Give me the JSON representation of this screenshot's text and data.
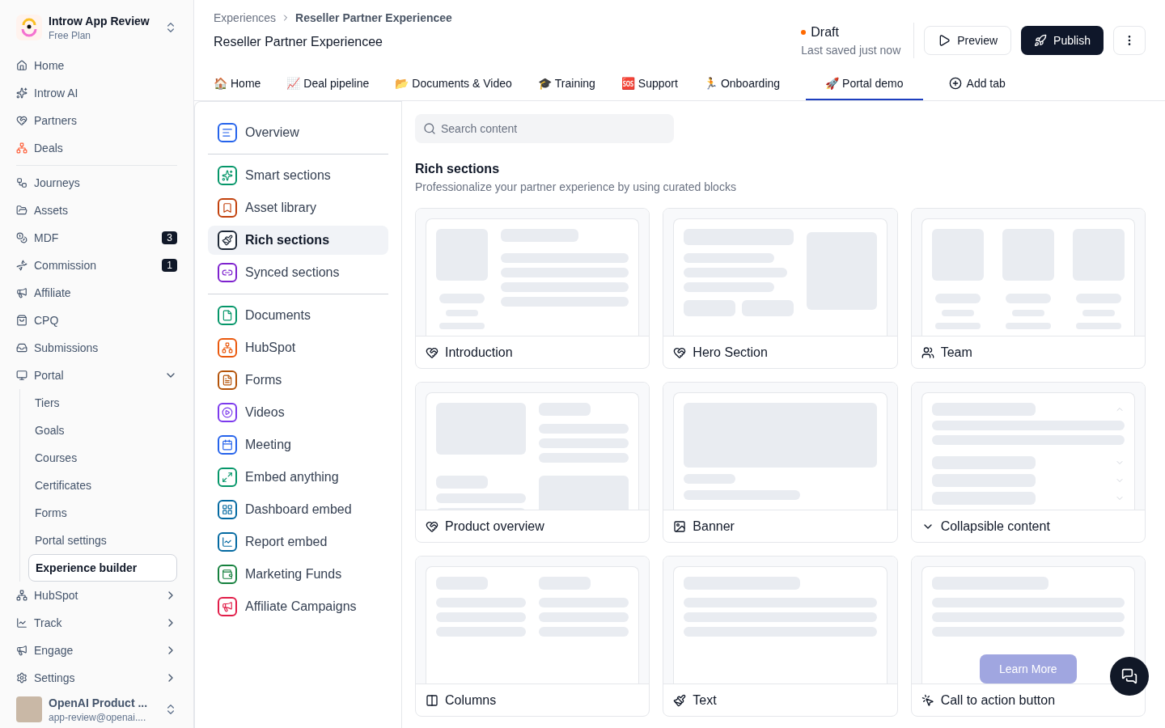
{
  "workspace": {
    "name": "Introw App Review",
    "plan": "Free Plan"
  },
  "nav": [
    {
      "kind": "item",
      "label": "Home"
    },
    {
      "kind": "item",
      "label": "Introw AI"
    },
    {
      "kind": "item",
      "label": "Partners"
    },
    {
      "kind": "item",
      "label": "Deals"
    },
    {
      "kind": "divider"
    },
    {
      "kind": "item",
      "label": "Journeys"
    },
    {
      "kind": "item",
      "label": "Assets"
    },
    {
      "kind": "item",
      "label": "MDF",
      "badge": "3"
    },
    {
      "kind": "item",
      "label": "Commission",
      "badge": "1"
    },
    {
      "kind": "item",
      "label": "Affiliate"
    },
    {
      "kind": "item",
      "label": "CPQ"
    },
    {
      "kind": "item",
      "label": "Submissions"
    },
    {
      "kind": "group",
      "label": "Portal",
      "expanded": true,
      "children": [
        {
          "label": "Tiers",
          "selected": false
        },
        {
          "label": "Goals",
          "selected": false
        },
        {
          "label": "Courses",
          "selected": false
        },
        {
          "label": "Certificates",
          "selected": false
        },
        {
          "label": "Forms",
          "selected": false
        },
        {
          "label": "Portal settings",
          "selected": false
        },
        {
          "label": "Experience builder",
          "selected": true
        }
      ]
    },
    {
      "kind": "group",
      "label": "HubSpot",
      "expanded": false
    },
    {
      "kind": "group",
      "label": "Track",
      "expanded": false
    },
    {
      "kind": "group",
      "label": "Engage",
      "expanded": false
    },
    {
      "kind": "group",
      "label": "Settings",
      "expanded": false
    }
  ],
  "user": {
    "name": "OpenAI Product ...",
    "email": "app-review@openai...."
  },
  "breadcrumb": [
    "Experiences",
    "Reseller Partner Experiencee"
  ],
  "title": "Reseller Partner Experiencee",
  "status": {
    "label": "Draft",
    "saved": "Last saved just now"
  },
  "actions": {
    "preview": "Preview",
    "publish": "Publish"
  },
  "tabs": [
    {
      "emoji": "🏠",
      "label": "Home",
      "selected": false
    },
    {
      "emoji": "📈",
      "label": "Deal pipeline",
      "selected": false
    },
    {
      "emoji": "📂",
      "label": "Documents & Video",
      "selected": false
    },
    {
      "emoji": "🎓",
      "label": "Training",
      "selected": false
    },
    {
      "emoji": "🆘",
      "label": "Support",
      "selected": false
    },
    {
      "emoji": "🏃",
      "label": "Onboarding",
      "selected": false
    },
    {
      "emoji": "🚀",
      "label": "Portal demo",
      "selected": true
    }
  ],
  "add_tab": "Add tab",
  "sections": [
    {
      "kind": "item",
      "label": "Overview",
      "color": "#2563eb",
      "selected": false
    },
    {
      "kind": "divider"
    },
    {
      "kind": "item",
      "label": "Smart sections",
      "color": "#059669",
      "selected": false
    },
    {
      "kind": "item",
      "label": "Asset library",
      "color": "#c2410c",
      "selected": false
    },
    {
      "kind": "item",
      "label": "Rich sections",
      "color": "#1f2937",
      "selected": true
    },
    {
      "kind": "item",
      "label": "Synced sections",
      "color": "#7e22ce",
      "selected": false
    },
    {
      "kind": "divider"
    },
    {
      "kind": "item",
      "label": "Documents",
      "color": "#059669",
      "selected": false
    },
    {
      "kind": "item",
      "label": "HubSpot",
      "color": "#ea580c",
      "selected": false
    },
    {
      "kind": "item",
      "label": "Forms",
      "color": "#b45309",
      "selected": false
    },
    {
      "kind": "item",
      "label": "Videos",
      "color": "#7c3aed",
      "selected": false
    },
    {
      "kind": "item",
      "label": "Meeting",
      "color": "#2563eb",
      "selected": false
    },
    {
      "kind": "item",
      "label": "Embed anything",
      "color": "#059669",
      "selected": false
    },
    {
      "kind": "item",
      "label": "Dashboard embed",
      "color": "#0369a1",
      "selected": false
    },
    {
      "kind": "item",
      "label": "Report embed",
      "color": "#0369a1",
      "selected": false
    },
    {
      "kind": "item",
      "label": "Marketing Funds",
      "color": "#15803d",
      "selected": false
    },
    {
      "kind": "item",
      "label": "Affiliate Campaigns",
      "color": "#e11d48",
      "selected": false
    }
  ],
  "search": {
    "placeholder": "Search content"
  },
  "heading": "Rich sections",
  "subheading": "Professionalize your partner experience by using curated blocks",
  "blocks": [
    {
      "kind": "intro",
      "title": "Introduction"
    },
    {
      "kind": "hero",
      "title": "Hero Section"
    },
    {
      "kind": "team",
      "title": "Team"
    },
    {
      "kind": "product",
      "title": "Product overview"
    },
    {
      "kind": "banner",
      "title": "Banner"
    },
    {
      "kind": "collapsible",
      "title": "Collapsible content"
    },
    {
      "kind": "columns",
      "title": "Columns"
    },
    {
      "kind": "text",
      "title": "Text"
    },
    {
      "kind": "cta",
      "title": "Call to action button",
      "button": "Learn More"
    }
  ]
}
